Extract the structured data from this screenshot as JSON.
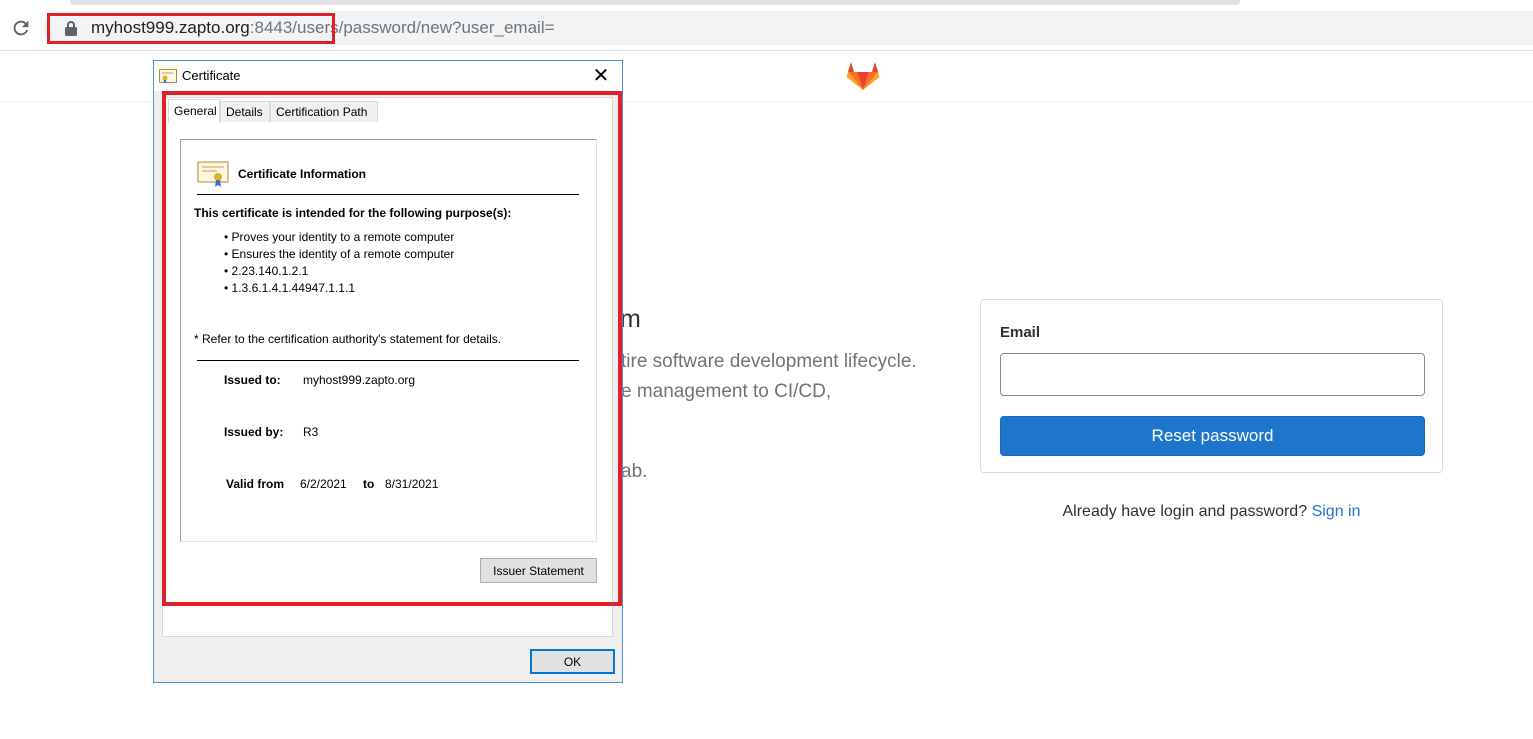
{
  "browser": {
    "url_host": "myhost999.zapto.org",
    "url_rest": ":8443/users/password/new?user_email="
  },
  "gitlab": {
    "heading_fragment": "m",
    "desc_lines": [
      "tire software development lifecycle.",
      "e management to CI/CD,",
      "ab."
    ],
    "email_label": "Email",
    "email_value": "",
    "reset_button": "Reset password",
    "signin_prompt": "Already have login and password?",
    "signin_link": "Sign in",
    "colors": {
      "primary": "#1f75cb",
      "highlight": "#e0202a"
    }
  },
  "certificate_dialog": {
    "title": "Certificate",
    "tabs": [
      "General",
      "Details",
      "Certification Path"
    ],
    "info_heading": "Certificate Information",
    "purpose_heading": "This certificate is intended for the following purpose(s):",
    "purposes": [
      "Proves your identity to a remote computer",
      "Ensures the identity of a remote computer",
      "2.23.140.1.2.1",
      "1.3.6.1.4.1.44947.1.1.1"
    ],
    "refer_note": "* Refer to the certification authority's statement for details.",
    "issued_to_label": "Issued to:",
    "issued_to": "myhost999.zapto.org",
    "issued_by_label": "Issued by:",
    "issued_by": "R3",
    "valid_from_label": "Valid from",
    "valid_from": "6/2/2021",
    "to_label": "to",
    "valid_to": "8/31/2021",
    "issuer_statement_button": "Issuer Statement",
    "ok_button": "OK"
  }
}
